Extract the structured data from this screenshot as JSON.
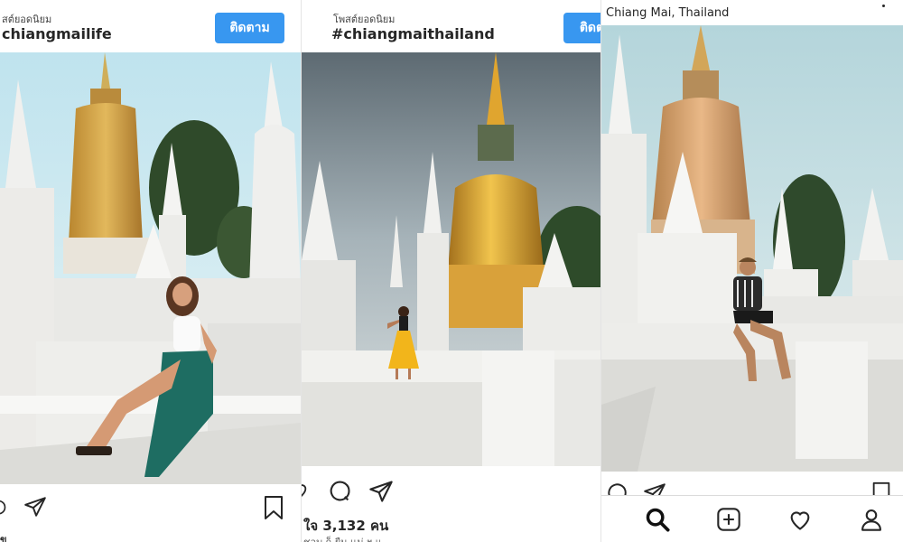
{
  "post1": {
    "subtitle": "สต์ยอดนิยม",
    "hashtag": "chiangmailife",
    "follow_label": "ติดตาม",
    "caption_fragment": "ข"
  },
  "post2": {
    "subtitle": "โพสต์ยอดนิยม",
    "hashtag": "#chiangmaithailand",
    "follow_label": "ติดตาม",
    "likes": "ใจ 3,132 คน",
    "caption_fragment": "ชอบ ก็ ยืน แม่ ฯ แ"
  },
  "post3": {
    "location": "Chiang Mai, Thailand"
  },
  "icons": {
    "share": "paper-plane-icon",
    "comment": "comment-bubble-icon",
    "save": "bookmark-icon",
    "nav": [
      "search-icon",
      "add-post-icon",
      "heart-icon",
      "profile-icon"
    ]
  },
  "colors": {
    "follow_button": "#3897f0",
    "gold_stupa": "#d9a53a",
    "white_temple": "#f3f3f1"
  }
}
